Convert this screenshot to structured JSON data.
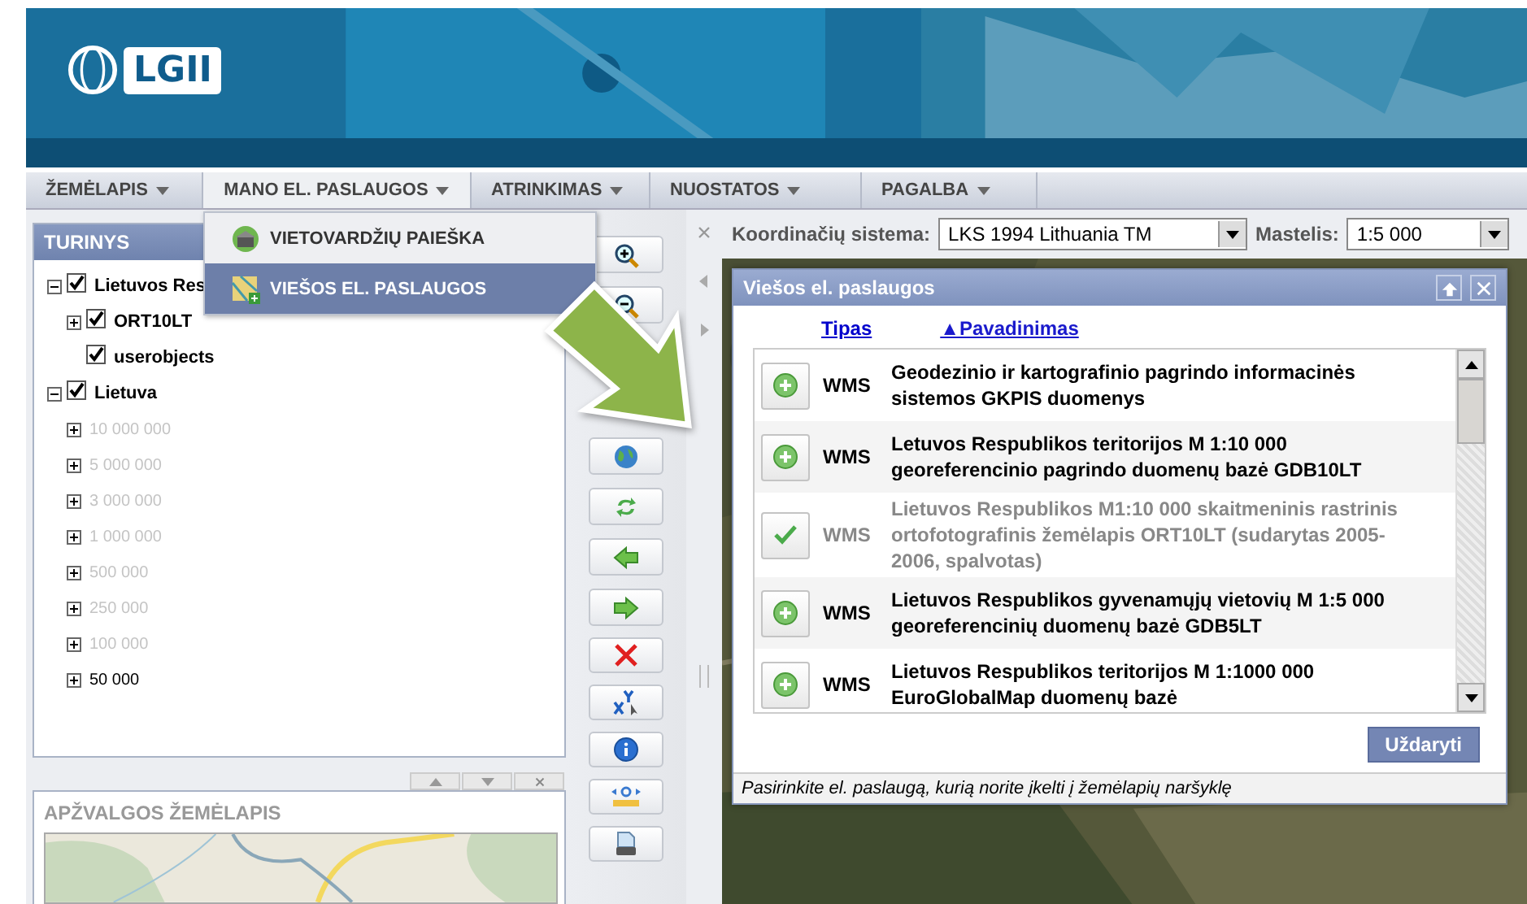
{
  "header": {
    "logo": "LGII"
  },
  "menu": [
    {
      "label": "ŽEMĖLAPIS",
      "selected": false
    },
    {
      "label": "MANO EL. PASLAUGOS",
      "selected": true
    },
    {
      "label": "ATRINKIMAS",
      "selected": false
    },
    {
      "label": "NUOSTATOS",
      "selected": false
    },
    {
      "label": "PAGALBA",
      "selected": false
    }
  ],
  "dropdown": [
    {
      "label": "VIETOVARDŽIŲ PAIEŠKA",
      "kind": "search",
      "selected": false
    },
    {
      "label": "VIEŠOS EL. PASLAUGOS",
      "kind": "services",
      "selected": true
    }
  ],
  "contents": {
    "title": "TURINYS",
    "tree": [
      {
        "label": "Lietuvos Res",
        "checked": true,
        "expanded": true,
        "disabled": false,
        "children": [
          {
            "label": "ORT10LT",
            "checked": true,
            "expanded": false,
            "disabled": false
          },
          {
            "label": "userobjects",
            "checked": true,
            "disabled": false
          }
        ]
      },
      {
        "label": "Lietuva",
        "checked": true,
        "expanded": true,
        "disabled": false,
        "children": [
          {
            "label": "10 000 000",
            "expanded": false,
            "disabled": true
          },
          {
            "label": "5 000 000",
            "expanded": false,
            "disabled": true
          },
          {
            "label": "3 000 000",
            "expanded": false,
            "disabled": true
          },
          {
            "label": "1 000 000",
            "expanded": false,
            "disabled": true
          },
          {
            "label": "500 000",
            "expanded": false,
            "disabled": true
          },
          {
            "label": "250 000",
            "expanded": false,
            "disabled": true
          },
          {
            "label": "100 000",
            "expanded": false,
            "disabled": true
          },
          {
            "label": "50 000",
            "expanded": false,
            "disabled": false
          }
        ]
      }
    ]
  },
  "overview": {
    "title": "APŽVALGOS ŽEMĖLAPIS"
  },
  "tools": [
    {
      "kind": "zoom-in"
    },
    {
      "kind": "zoom-out"
    },
    {
      "kind": "hidden"
    },
    {
      "kind": "hidden"
    },
    {
      "kind": "globe"
    },
    {
      "kind": "refresh"
    },
    {
      "kind": "back"
    },
    {
      "kind": "forward"
    },
    {
      "kind": "delete"
    },
    {
      "kind": "xy"
    },
    {
      "kind": "info"
    },
    {
      "kind": "measure"
    },
    {
      "kind": "print"
    }
  ],
  "coords": {
    "system_label": "Koordinačių sistema:",
    "system": "LKS 1994 Lithuania TM",
    "scale_label": "Mastelis:",
    "scale": "1:5 000"
  },
  "dialog": {
    "title": "Viešos el. paslaugos",
    "sort_links": [
      {
        "label": "Tipas",
        "selected": false
      },
      {
        "label": "▲Pavadinimas",
        "selected": true
      }
    ],
    "rows": [
      {
        "type": "WMS",
        "name": "Geodezinio ir kartografinio pagrindo informacinės sistemos GKPIS duomenys",
        "added": false
      },
      {
        "type": "WMS",
        "name": "Letuvos Respublikos teritorijos M 1:10 000 georeferencinio pagrindo duomenų bazė GDB10LT",
        "added": false
      },
      {
        "type": "WMS",
        "name": "Lietuvos Respublikos M1:10 000 skaitmeninis rastrinis ortofotografinis žemėlapis ORT10LT (sudarytas 2005-2006, spalvotas)",
        "added": true
      },
      {
        "type": "WMS",
        "name": "Lietuvos Respublikos gyvenamųjų vietovių M 1:5 000 georeferencinių duomenų bazė GDB5LT",
        "added": false
      },
      {
        "type": "WMS",
        "name": "Lietuvos Respublikos teritorijos M 1:1000 000 EuroGlobalMap duomenų bazė",
        "added": false
      }
    ],
    "close_button": "Uždaryti",
    "status": "Pasirinkite el. paslaugą, kurią norite įkelti į žemėlapių naršyklę"
  }
}
